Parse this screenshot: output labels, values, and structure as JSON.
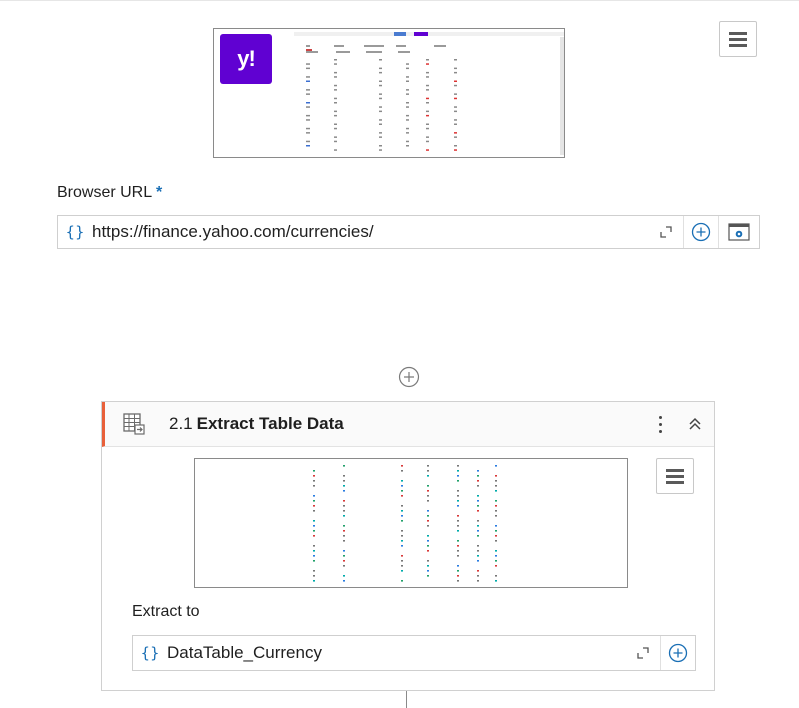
{
  "open_browser": {
    "thumbnail": {
      "logo_text": "y!",
      "logo_color": "#6001d2",
      "image_alt": "Yahoo Finance currencies page screenshot"
    },
    "url_field": {
      "label": "Browser URL",
      "required_marker": "*",
      "value": "https://finance.yahoo.com/currencies/",
      "type_icon": "{}"
    }
  },
  "add_activity_icon": "plus-circle-icon",
  "extract_activity": {
    "number": "2.1",
    "title": "Extract Table Data",
    "accent_color": "#e8603a",
    "output_field": {
      "label": "Extract to",
      "value": "DataTable_Currency",
      "type_icon": "{}"
    }
  }
}
